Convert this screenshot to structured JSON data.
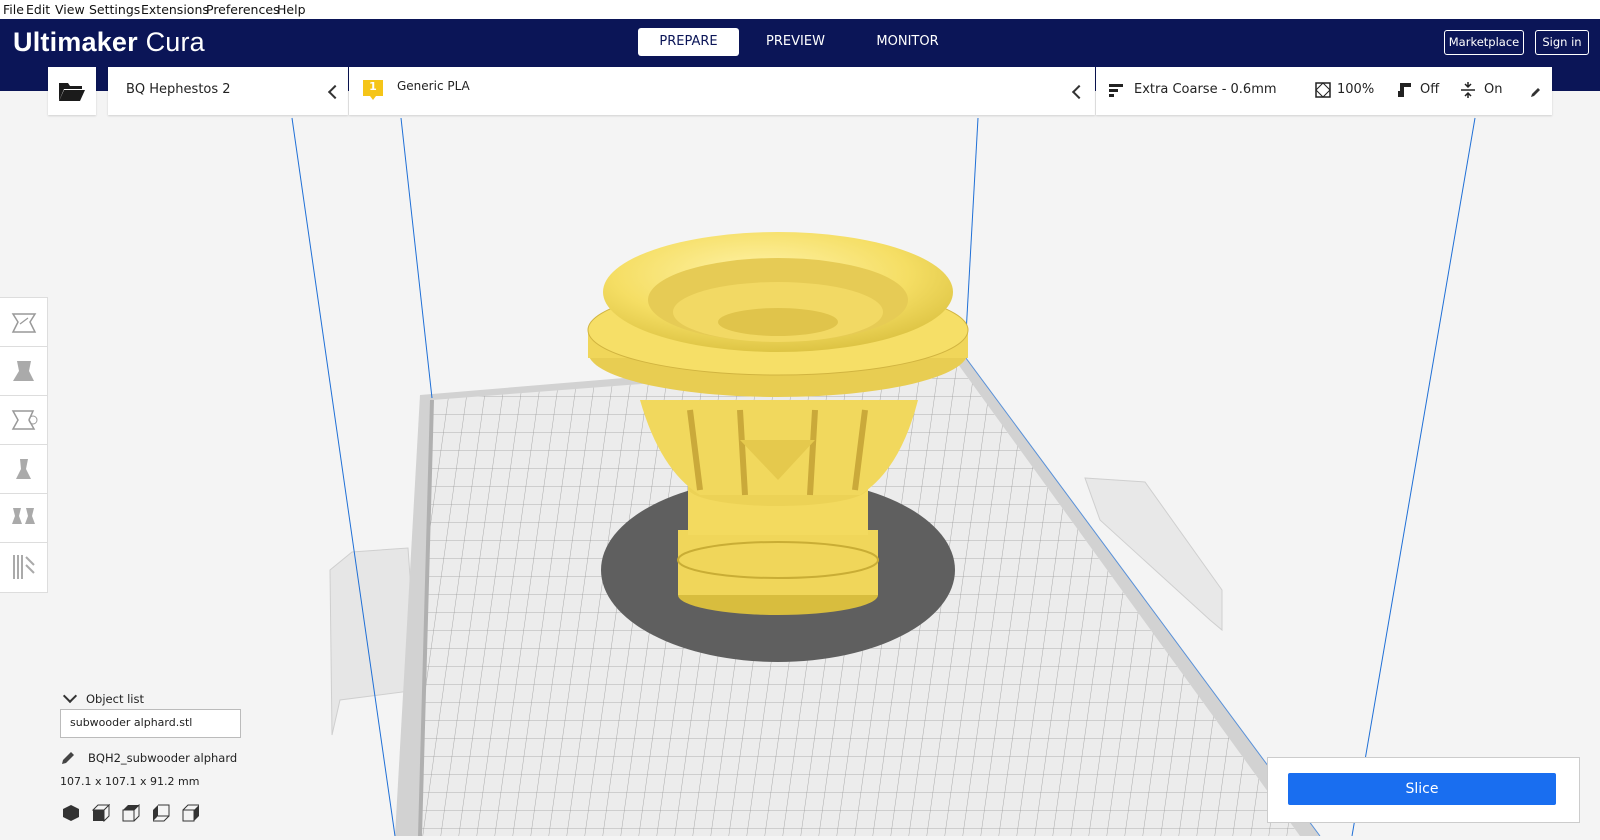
{
  "menu": [
    "File",
    "Edit",
    "View",
    "Settings",
    "Extensions",
    "Preferences",
    "Help"
  ],
  "app": {
    "brand_bold": "Ultimaker",
    "brand_thin": "Cura"
  },
  "tabs": {
    "prepare": "PREPARE",
    "preview": "PREVIEW",
    "monitor": "MONITOR"
  },
  "header_buttons": {
    "marketplace": "Marketplace",
    "signin": "Sign in"
  },
  "printer": {
    "name": "BQ Hephestos 2"
  },
  "material": {
    "extruder_number": "1",
    "name": "Generic PLA"
  },
  "print_settings": {
    "profile": "Extra Coarse - 0.6mm",
    "infill": "100%",
    "support": "Off",
    "adhesion": "On"
  },
  "object_list": {
    "header": "Object list",
    "filename": "subwooder alphard.stl",
    "object_name": "BQH2_subwooder alphard",
    "dimensions": "107.1 x 107.1 x 91.2 mm"
  },
  "actions": {
    "slice": "Slice"
  },
  "colors": {
    "header_bg": "#0b1557",
    "accent": "#196ef0",
    "model": "#f5e06a",
    "badge": "#f5c518"
  },
  "icons": {
    "open": "folder-open-icon",
    "move": "move-tool-icon",
    "scale": "scale-tool-icon",
    "rotate": "rotate-tool-icon",
    "mirror": "mirror-tool-icon",
    "per_model": "per-model-settings-icon",
    "support_blocker": "support-blocker-icon",
    "edit": "pencil-icon",
    "view3d": "3d-view-icon",
    "front": "front-view-icon",
    "top": "top-view-icon",
    "left": "left-view-icon",
    "right": "right-view-icon"
  }
}
